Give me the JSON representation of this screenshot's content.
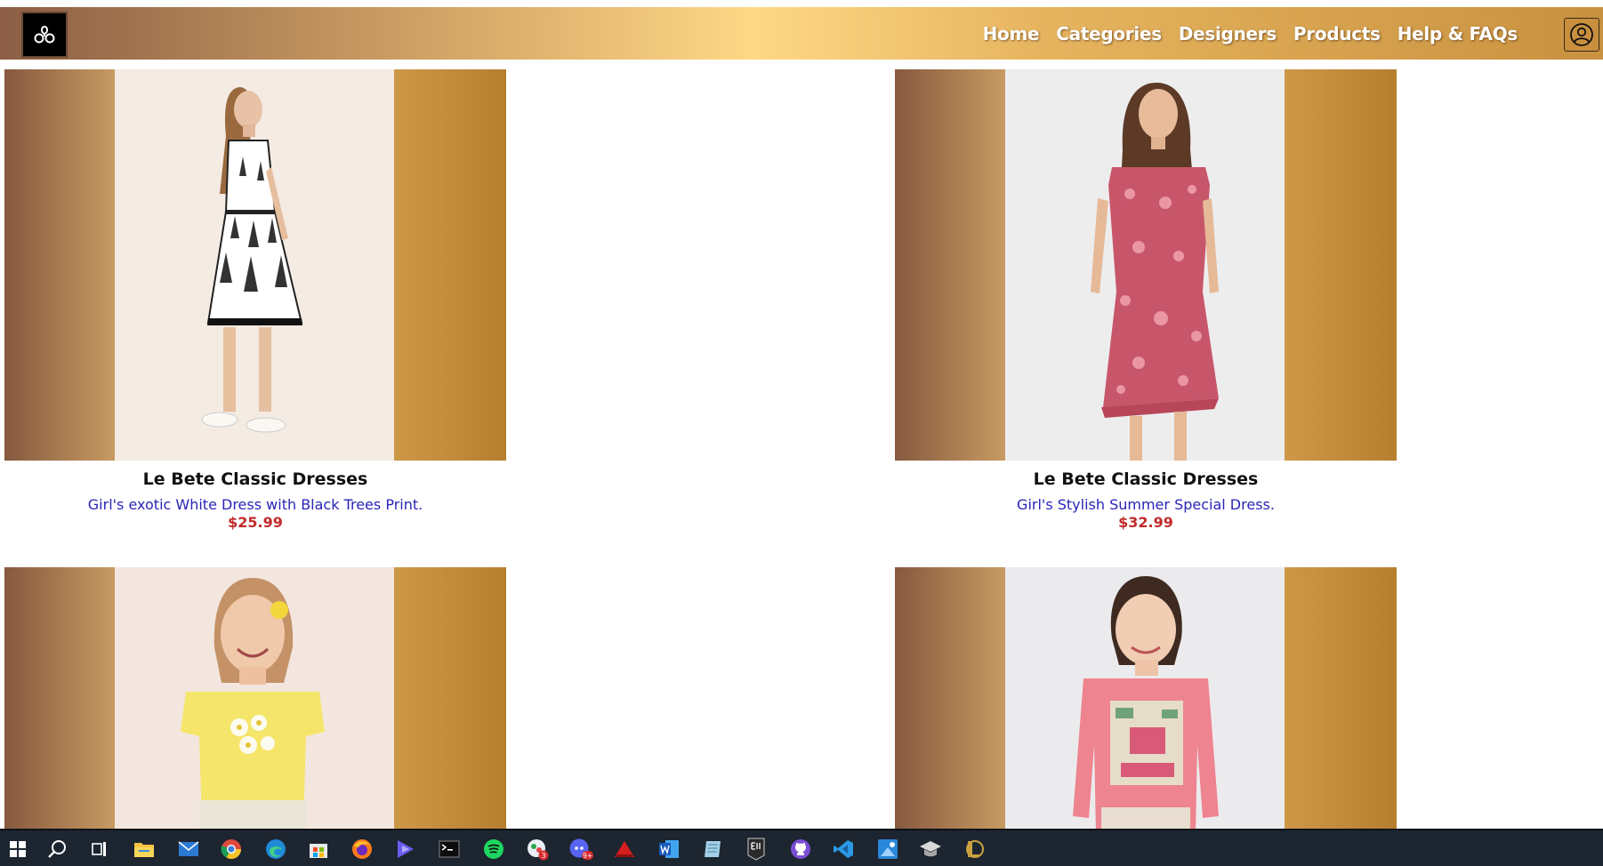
{
  "header": {
    "logo_icon": "triskelion-logo-icon",
    "nav": [
      "Home",
      "Categories",
      "Designers",
      "Products",
      "Help & FAQs"
    ],
    "account_icon": "user-circle-icon"
  },
  "products": [
    {
      "title": "Le Bete Classic Dresses",
      "description": "Girl's exotic White Dress with Black Trees Print.",
      "price": "$25.99",
      "image": "girl-white-palm-dress-photo"
    },
    {
      "title": "Le Bete Classic Dresses",
      "description": "Girl's Stylish Summer Special Dress.",
      "price": "$32.99",
      "image": "girl-pink-floral-dress-photo"
    },
    {
      "title": "",
      "description": "",
      "price": "",
      "image": "girl-yellow-flower-top-photo"
    },
    {
      "title": "",
      "description": "",
      "price": "",
      "image": "girl-pink-longsleeve-top-photo"
    }
  ],
  "taskbar": {
    "icons": [
      "windows-start-icon",
      "search-icon",
      "task-view-icon",
      "file-explorer-icon",
      "mail-icon",
      "chrome-icon",
      "edge-icon",
      "store-icon",
      "firefox-icon",
      "video-editor-icon",
      "terminal-icon",
      "spotify-icon",
      "chat-app-icon",
      "discord-icon",
      "game-launcher-icon",
      "word-icon",
      "notes-icon",
      "epic-games-icon",
      "github-icon",
      "vscode-icon",
      "paint-icon",
      "education-icon",
      "league-icon"
    ],
    "chat_badge": "3",
    "discord_badge": "9+"
  }
}
